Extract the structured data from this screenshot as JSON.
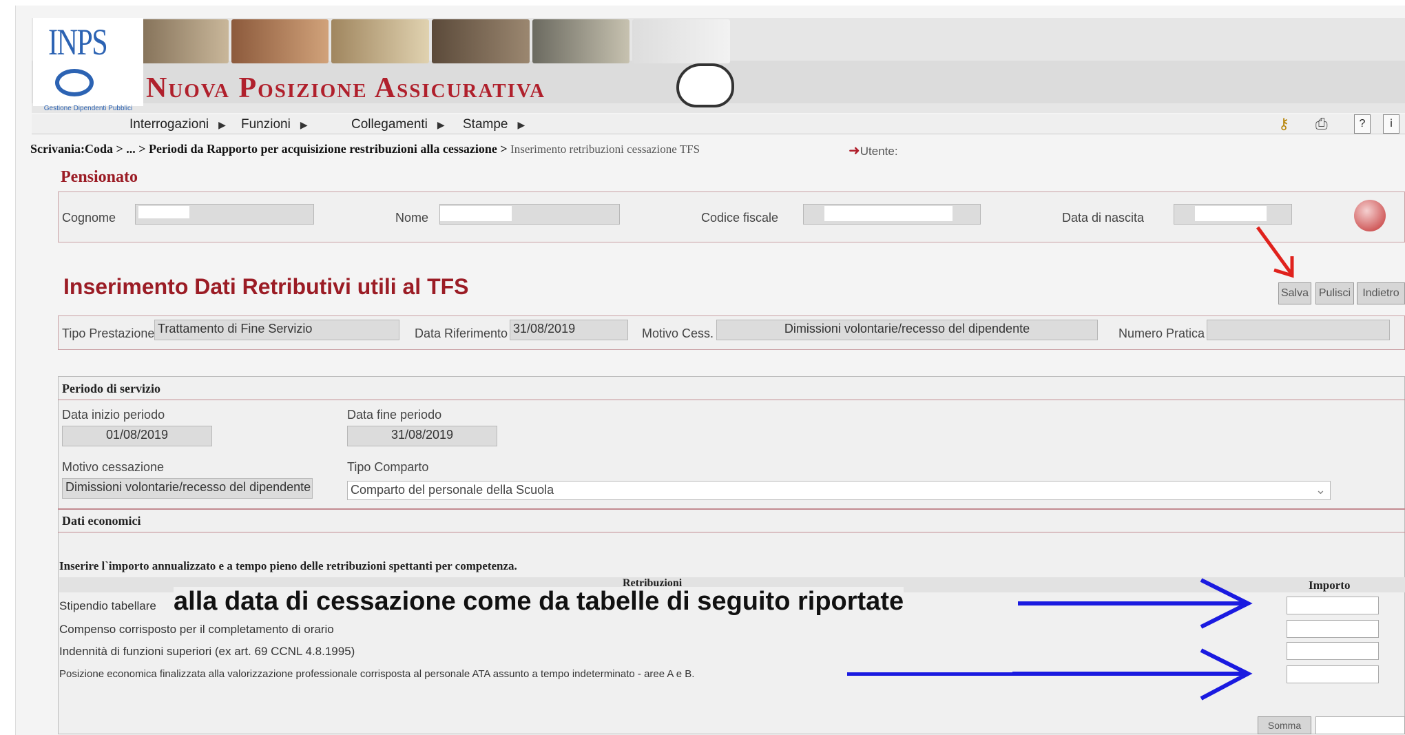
{
  "header": {
    "logo_text": "INPS",
    "logo_subtitle": "Gestione Dipendenti Pubblici",
    "app_title": "Nuova Posizione Assicurativa"
  },
  "menu": [
    {
      "label": "Interrogazioni"
    },
    {
      "label": "Funzioni"
    },
    {
      "label": "Collegamenti"
    },
    {
      "label": "Stampe"
    }
  ],
  "toolbar": {
    "help": "?",
    "info": "i"
  },
  "breadcrumb": {
    "path": "Scrivania:Coda > ... > Periodi da Rapporto per acquisizione restribuzioni alla cessazione >",
    "current": "Inserimento retribuzioni cessazione TFS",
    "utente_label": "Utente:"
  },
  "pensionato": {
    "title": "Pensionato",
    "cognome_label": "Cognome",
    "nome_label": "Nome",
    "codice_fiscale_label": "Codice fiscale",
    "data_nascita_label": "Data di nascita"
  },
  "page_title": "Inserimento Dati Retributivi utili al TFS",
  "buttons": {
    "salva": "Salva",
    "pulisci": "Pulisci",
    "indietro": "Indietro",
    "somma": "Somma"
  },
  "prestazione": {
    "tipo_label": "Tipo Prestazione",
    "tipo_value": "Trattamento di Fine Servizio",
    "data_rif_label": "Data Riferimento",
    "data_rif_value": "31/08/2019",
    "motivo_label": "Motivo Cess.",
    "motivo_value": "Dimissioni volontarie/recesso del dipendente",
    "numero_label": "Numero Pratica",
    "numero_value": ""
  },
  "periodo": {
    "title": "Periodo di servizio",
    "inizio_label": "Data inizio periodo",
    "inizio_value": "01/08/2019",
    "fine_label": "Data fine periodo",
    "fine_value": "31/08/2019",
    "motivo_label": "Motivo cessazione",
    "motivo_value": "Dimissioni volontarie/recesso del dipendente",
    "comparto_label": "Tipo Comparto",
    "comparto_value": "Comparto del personale della Scuola"
  },
  "economici": {
    "title": "Dati economici",
    "instruction": "Inserire l`importo annualizzato e a tempo pieno delle retribuzioni spettanti per competenza.",
    "col_retribuzioni": "Retribuzioni",
    "col_importo": "Importo",
    "rows": [
      {
        "label": "Stipendio tabellare"
      },
      {
        "label": "Compenso corrisposto per il completamento di orario"
      },
      {
        "label": "Indennità di funzioni superiori (ex art. 69 CCNL 4.8.1995)"
      },
      {
        "label": "Posizione economica finalizzata alla valorizzazione professionale corrisposta al personale ATA assunto a tempo indeterminato - aree A e B."
      }
    ]
  },
  "annotation": {
    "overlay_text": "alla data di cessazione come da tabelle di seguito riportate",
    "arrow_colors": {
      "red": "#e0221d",
      "blue": "#1a1ae0"
    }
  }
}
